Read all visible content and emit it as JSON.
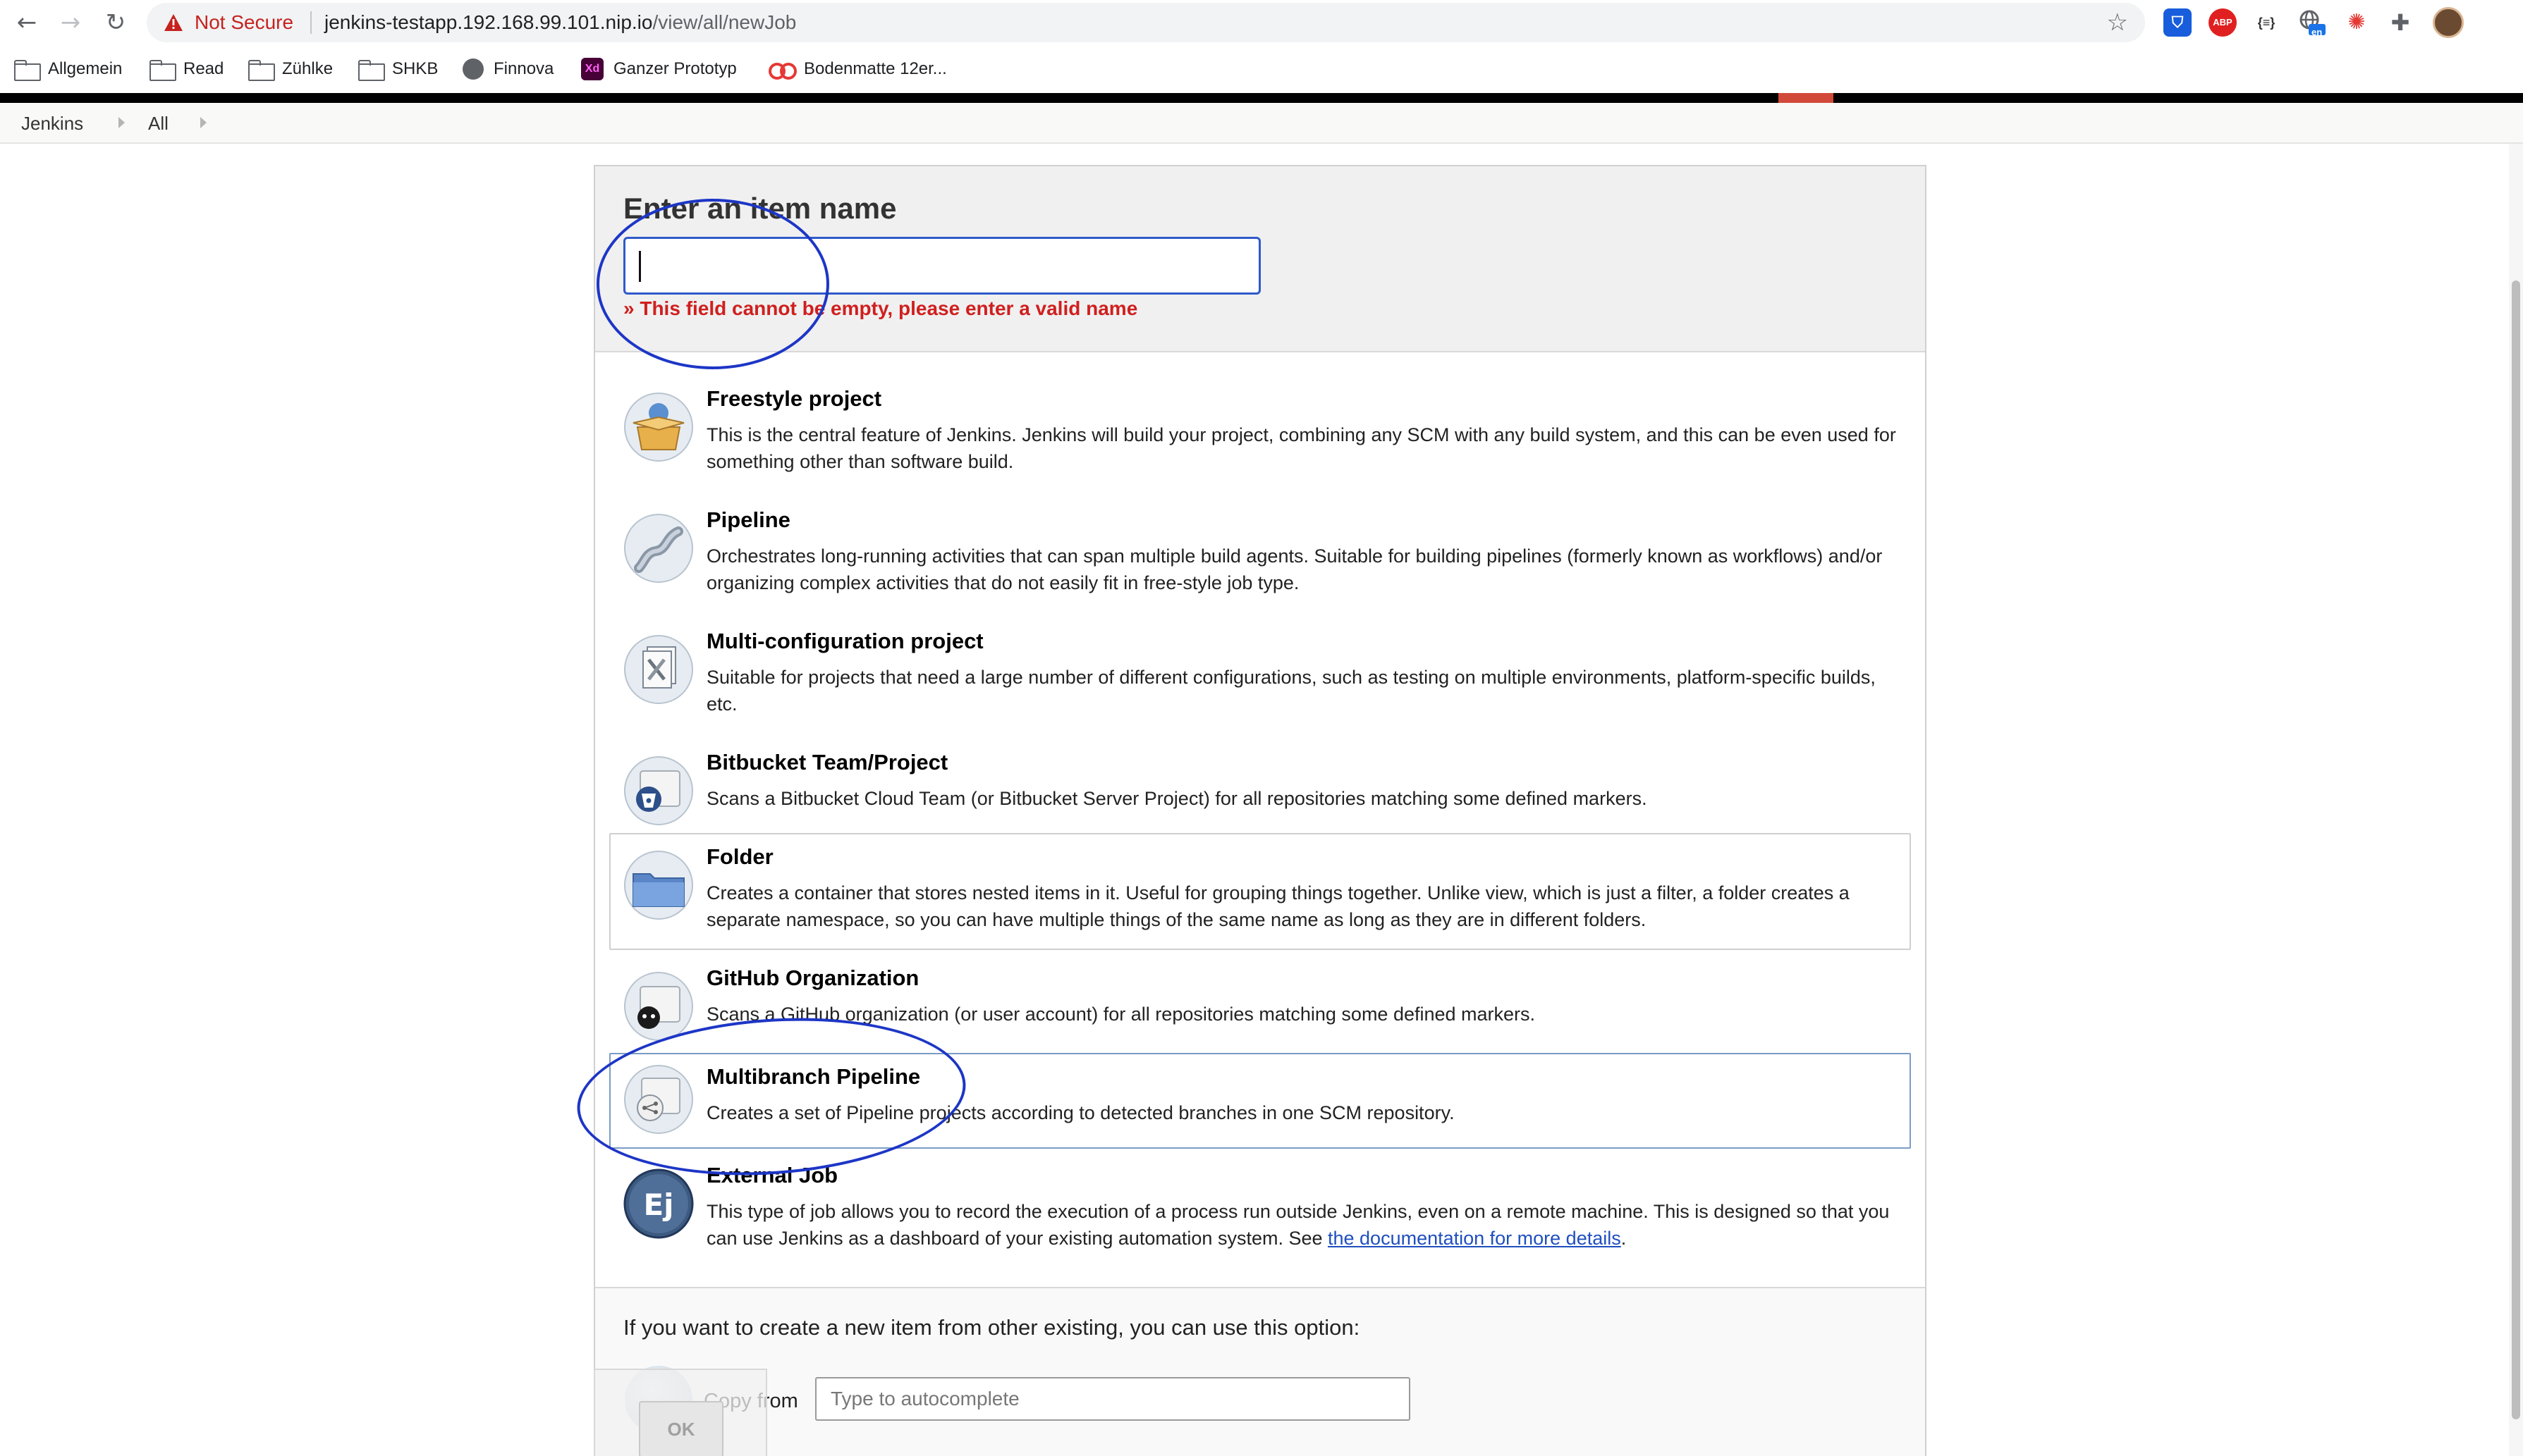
{
  "browser": {
    "security_label": "Not Secure",
    "url_host": "jenkins-testapp.192.168.99.101.nip.io",
    "url_path": "/view/all/newJob",
    "bookmarks": [
      {
        "label": "Allgemein",
        "icon": "folder-icon"
      },
      {
        "label": "Read",
        "icon": "folder-icon"
      },
      {
        "label": "Zühlke",
        "icon": "folder-icon"
      },
      {
        "label": "SHKB",
        "icon": "folder-icon"
      },
      {
        "label": "Finnova",
        "icon": "globe-icon"
      },
      {
        "label": "Ganzer Prototyp",
        "icon": "adobe-xd-icon"
      },
      {
        "label": "Bodenmatte 12er...",
        "icon": "glasses-icon"
      }
    ],
    "extensions": {
      "abp": "ABP",
      "json": "{≡}",
      "lang_badge": "en"
    }
  },
  "breadcrumb": {
    "items": [
      "Jenkins",
      "All"
    ]
  },
  "form": {
    "title": "Enter an item name",
    "name_value": "",
    "error": "» This field cannot be empty, please enter a valid name"
  },
  "items": [
    {
      "title": "Freestyle project",
      "description": "This is the central feature of Jenkins. Jenkins will build your project, combining any SCM with any build system, and this can be even used for something other than software build.",
      "icon": "freestyle-box-icon"
    },
    {
      "title": "Pipeline",
      "description": "Orchestrates long-running activities that can span multiple build agents. Suitable for building pipelines (formerly known as workflows) and/or organizing complex activities that do not easily fit in free-style job type.",
      "icon": "pipeline-icon"
    },
    {
      "title": "Multi-configuration project",
      "description": "Suitable for projects that need a large number of different configurations, such as testing on multiple environments, platform-specific builds, etc.",
      "icon": "multi-config-icon"
    },
    {
      "title": "Bitbucket Team/Project",
      "description": "Scans a Bitbucket Cloud Team (or Bitbucket Server Project) for all repositories matching some defined markers.",
      "icon": "bitbucket-icon"
    },
    {
      "title": "Folder",
      "description": "Creates a container that stores nested items in it. Useful for grouping things together. Unlike view, which is just a filter, a folder creates a separate namespace, so you can have multiple things of the same name as long as they are in different folders.",
      "icon": "folder-item-icon"
    },
    {
      "title": "GitHub Organization",
      "description": "Scans a GitHub organization (or user account) for all repositories matching some defined markers.",
      "icon": "github-icon"
    },
    {
      "title": "Multibranch Pipeline",
      "description": "Creates a set of Pipeline projects according to detected branches in one SCM repository.",
      "icon": "multibranch-icon"
    },
    {
      "title": "External Job",
      "description_before_link": "This type of job allows you to record the execution of a process run outside Jenkins, even on a remote machine. This is designed so that you can use Jenkins as a dashboard of your existing automation system. See ",
      "link": "the documentation for more details",
      "description_after_link": ".",
      "icon": "external-job-icon",
      "icon_text": "Ej"
    }
  ],
  "copy": {
    "hint": "If you want to create a new item from other existing, you can use this option:",
    "label": "Copy from",
    "placeholder": "Type to autocomplete"
  },
  "ok_button": "OK",
  "colors": {
    "accent_blue": "#2f5ac9",
    "error_red": "#d01f1f",
    "jenkins_red": "#d24939",
    "annotation": "#1d36c6"
  }
}
